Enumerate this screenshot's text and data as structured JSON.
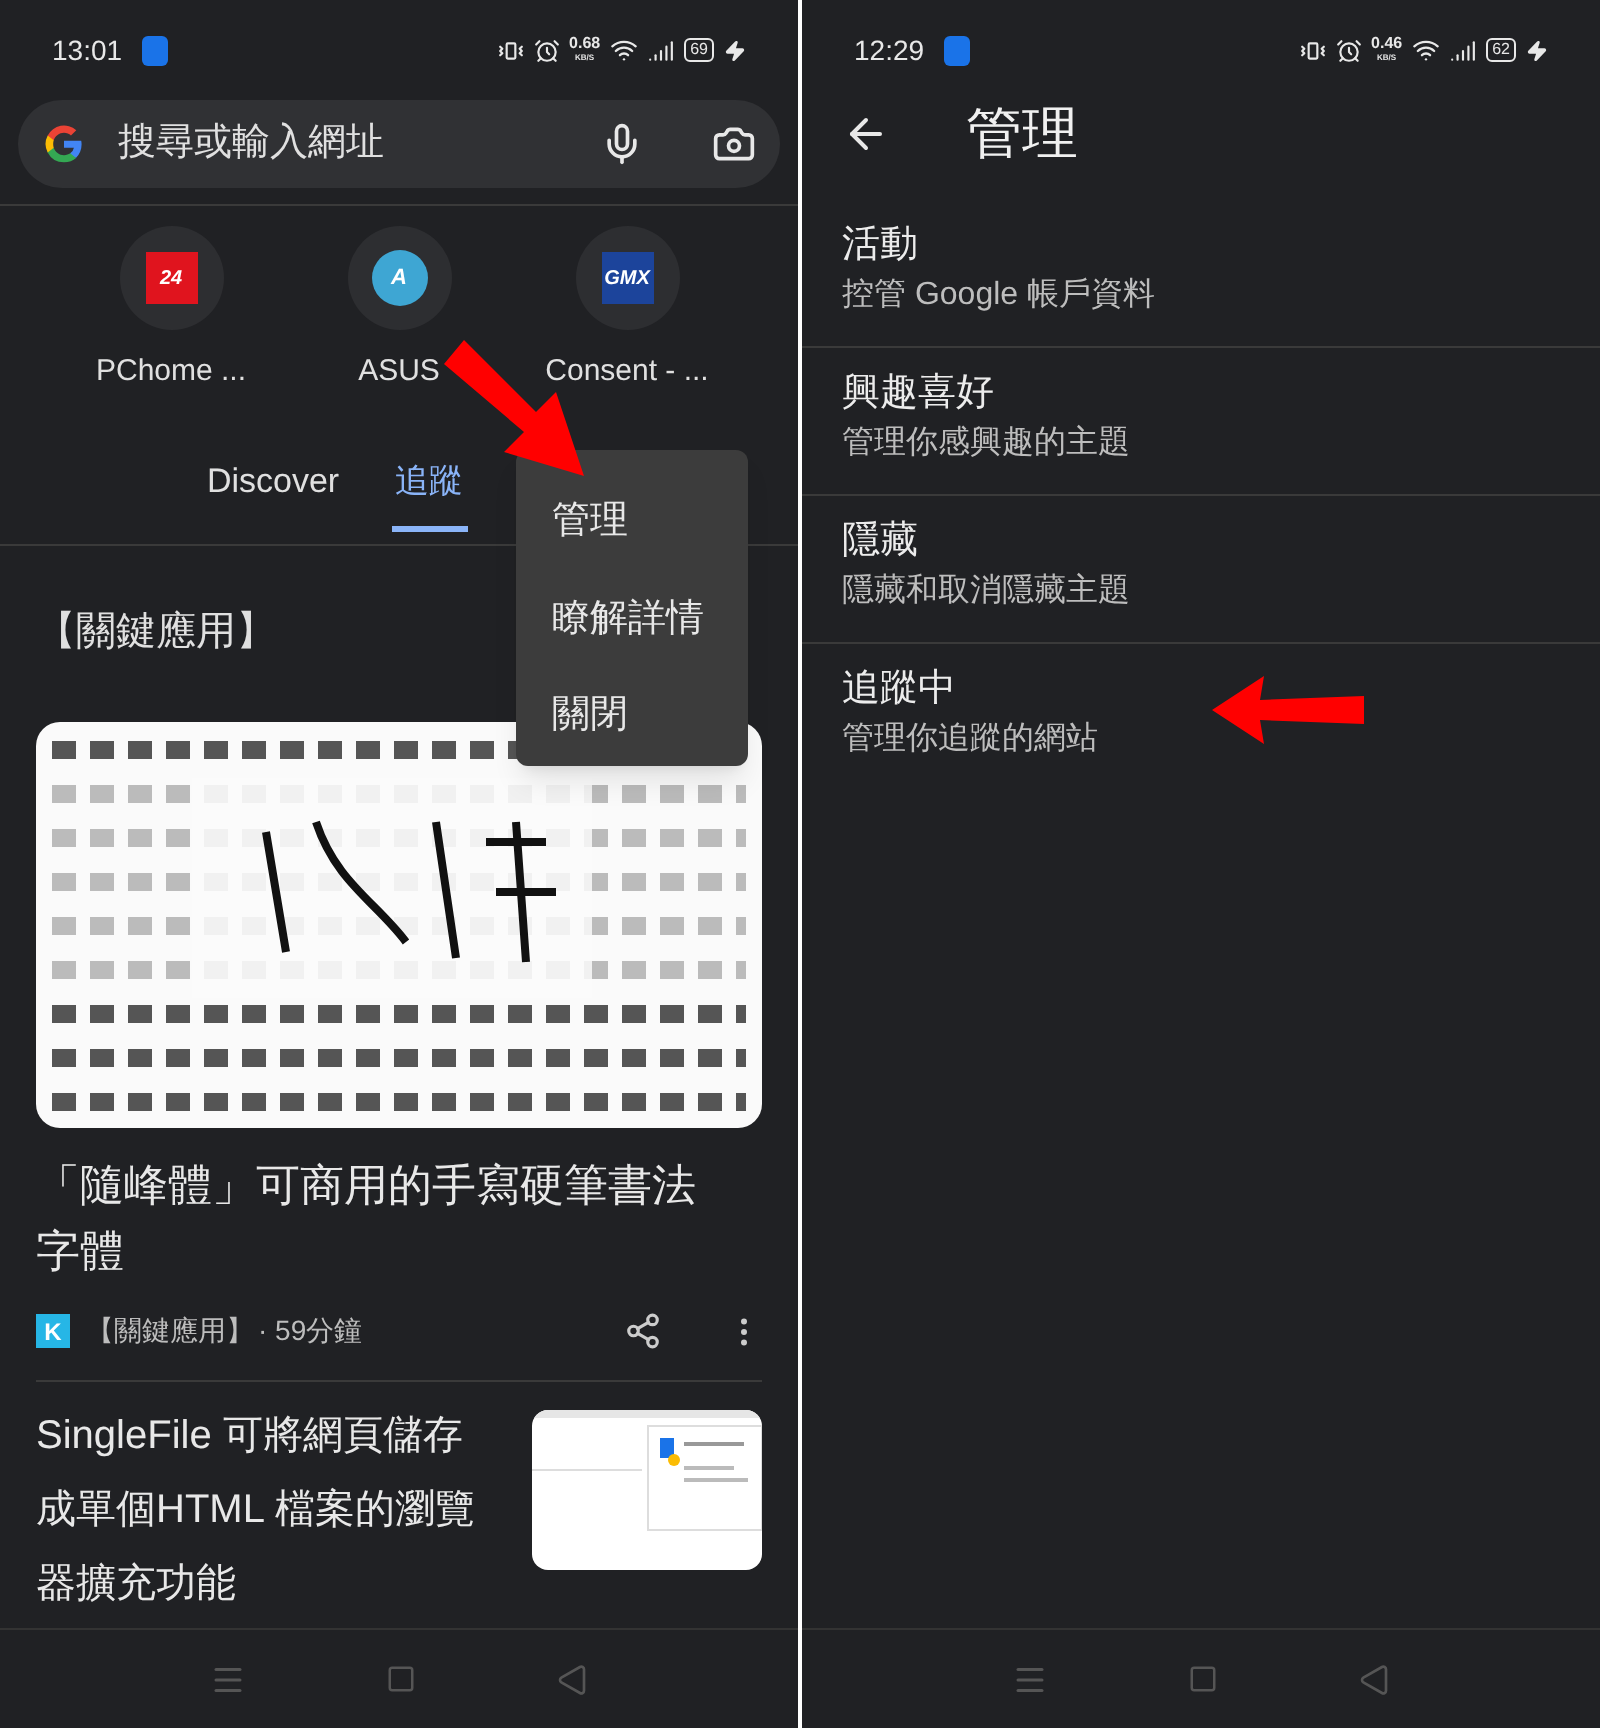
{
  "left_screen": {
    "status_bar": {
      "time": "13:01",
      "speed": "0.68",
      "speed_unit": "KB/S",
      "battery": "69"
    },
    "search": {
      "placeholder": "搜尋或輸入網址"
    },
    "shortcuts": [
      {
        "label": "PChome ...",
        "icon_text": "24",
        "kind": "square",
        "color": "#e0141e"
      },
      {
        "label": "ASUS",
        "icon_text": "A",
        "kind": "circle",
        "color": "#3ea6d3"
      },
      {
        "label": "Consent - ...",
        "icon_text": "GMX",
        "kind": "square",
        "color": "#1c449b"
      }
    ],
    "tabs": [
      {
        "label": "Discover",
        "selected": false
      },
      {
        "label": "追蹤",
        "selected": true
      }
    ],
    "menu": [
      "管理",
      "瞭解詳情",
      "關閉"
    ],
    "feed_header": "【關鍵應用】",
    "article": {
      "title": "「隨峰體」可商用的手寫硬筆書法字體",
      "source_badge": "K",
      "source": "【關鍵應用】",
      "time": "· 59分鐘"
    },
    "article_2": {
      "title": "SingleFile 可將網頁儲存成單個HTML 檔案的瀏覽器擴充功能"
    }
  },
  "right_screen": {
    "status_bar": {
      "time": "12:29",
      "speed": "0.46",
      "speed_unit": "KB/S",
      "battery": "62"
    },
    "title": "管理",
    "items": [
      {
        "title": "活動",
        "subtitle": "控管 Google 帳戶資料"
      },
      {
        "title": "興趣喜好",
        "subtitle": "管理你感興趣的主題"
      },
      {
        "title": "隱藏",
        "subtitle": "隱藏和取消隱藏主題"
      },
      {
        "title": "追蹤中",
        "subtitle": "管理你追蹤的網站"
      }
    ]
  }
}
